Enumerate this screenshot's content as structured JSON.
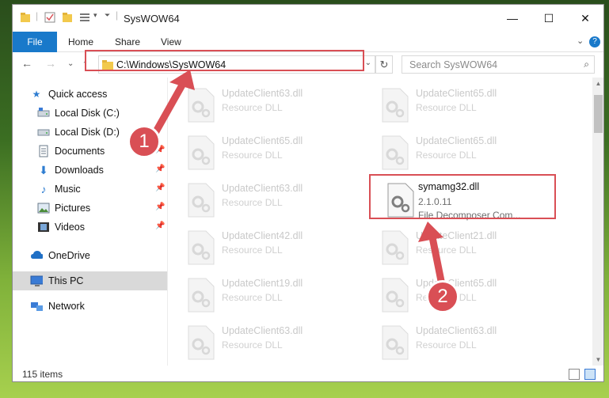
{
  "window": {
    "title": "SysWOW64",
    "minimize": "—",
    "maximize": "☐",
    "close": "✕"
  },
  "ribbon": {
    "tabs": [
      "File",
      "Home",
      "Share",
      "View"
    ],
    "expand": "⌄",
    "help": "?"
  },
  "nav": {
    "back": "←",
    "forward": "→",
    "recent": "⌄",
    "up": "↑",
    "address": "C:\\Windows\\SysWOW64",
    "address_dropdown": "⌄",
    "refresh": "↻",
    "search_placeholder": "Search SysWOW64",
    "search_icon": "⌕"
  },
  "sidebar": {
    "items": [
      {
        "label": "Quick access",
        "icon": "star-icon",
        "pinned": false
      },
      {
        "label": "Local Disk (C:)",
        "icon": "drive-icon",
        "pinned": false
      },
      {
        "label": "Local Disk (D:)",
        "icon": "drive-icon",
        "pinned": false
      },
      {
        "label": "Documents",
        "icon": "documents-icon",
        "pinned": true
      },
      {
        "label": "Downloads",
        "icon": "download-icon",
        "pinned": true
      },
      {
        "label": "Music",
        "icon": "music-icon",
        "pinned": true
      },
      {
        "label": "Pictures",
        "icon": "pictures-icon",
        "pinned": true
      },
      {
        "label": "Videos",
        "icon": "videos-icon",
        "pinned": true
      },
      {
        "label": "OneDrive",
        "icon": "cloud-icon",
        "pinned": false
      },
      {
        "label": "This PC",
        "icon": "computer-icon",
        "pinned": false,
        "selected": true
      },
      {
        "label": "Network",
        "icon": "network-icon",
        "pinned": false
      }
    ]
  },
  "files": [
    {
      "name": "UpdateClient63.dll",
      "type": "Resource DLL"
    },
    {
      "name": "UpdateClient65.dll",
      "type": "Resource DLL"
    },
    {
      "name": "UpdateClient65.dll",
      "type": "Resource DLL"
    },
    {
      "name": "UpdateClient65.dll",
      "type": "Resource DLL"
    },
    {
      "name": "UpdateClient63.dll",
      "type": "Resource DLL"
    },
    {
      "name": "UpdateClient42.dll",
      "type": "Resource DLL"
    },
    {
      "name": "UpdateClient21.dll",
      "type": "Resource DLL"
    },
    {
      "name": "UpdateClient19.dll",
      "type": "Resource DLL"
    },
    {
      "name": "UpdateClient65.dll",
      "type": "Resource DLL"
    },
    {
      "name": "UpdateClient63.dll",
      "type": "Resource DLL"
    },
    {
      "name": "UpdateClient63.dll",
      "type": "Resource DLL"
    }
  ],
  "highlighted_file": {
    "name": "symamg32.dll",
    "version": "2.1.0.11",
    "description": "File Decomposer Com..."
  },
  "status": {
    "item_count": "115 items"
  },
  "annotations": {
    "step1": "1",
    "step2": "2",
    "color": "#d94f55"
  }
}
